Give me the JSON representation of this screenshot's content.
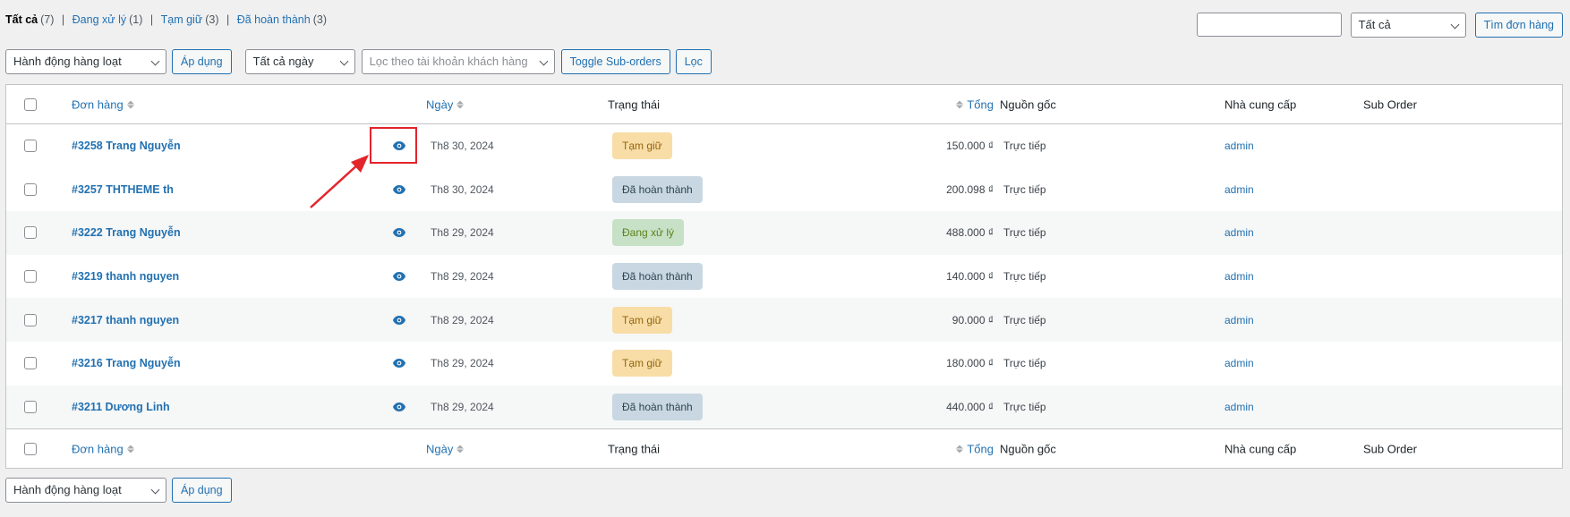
{
  "status_filter": {
    "items": [
      {
        "label": "Tất cả",
        "count": "(7)",
        "current": true
      },
      {
        "label": "Đang xử lý",
        "count": "(1)",
        "current": false
      },
      {
        "label": "Tạm giữ",
        "count": "(3)",
        "current": false
      },
      {
        "label": "Đã hoàn thành",
        "count": "(3)",
        "current": false
      }
    ],
    "separator": "|"
  },
  "search": {
    "input_value": "",
    "filter_select": "Tất cả",
    "button_label": "Tìm đơn hàng"
  },
  "top_nav": {
    "bulk_action": "Hành động hàng loạt",
    "apply_label": "Áp dụng",
    "date_filter": "Tất cả ngày",
    "customer_filter_placeholder": "Lọc theo tài khoản khách hàng",
    "toggle_suborders_label": "Toggle Sub-orders",
    "filter_label": "Lọc"
  },
  "bottom_nav": {
    "bulk_action": "Hành động hàng loạt",
    "apply_label": "Áp dụng"
  },
  "columns": {
    "order": "Đơn hàng",
    "date": "Ngày",
    "status": "Trạng thái",
    "total": "Tổng",
    "origin": "Nguồn gốc",
    "vendor": "Nhà cung cấp",
    "sub_order": "Sub Order"
  },
  "orders": [
    {
      "order": "#3258 Trang Nguyễn",
      "date": "Th8 30, 2024",
      "status": "Tạm giữ",
      "status_type": "on-hold",
      "total": "150.000 ₫",
      "origin": "Trực tiếp",
      "vendor": "admin"
    },
    {
      "order": "#3257 THTHEME th",
      "date": "Th8 30, 2024",
      "status": "Đã hoàn thành",
      "status_type": "completed",
      "total": "200.098 ₫",
      "origin": "Trực tiếp",
      "vendor": "admin"
    },
    {
      "order": "#3222 Trang Nguyễn",
      "date": "Th8 29, 2024",
      "status": "Đang xử lý",
      "status_type": "processing",
      "total": "488.000 ₫",
      "origin": "Trực tiếp",
      "vendor": "admin"
    },
    {
      "order": "#3219 thanh nguyen",
      "date": "Th8 29, 2024",
      "status": "Đã hoàn thành",
      "status_type": "completed",
      "total": "140.000 ₫",
      "origin": "Trực tiếp",
      "vendor": "admin"
    },
    {
      "order": "#3217 thanh nguyen",
      "date": "Th8 29, 2024",
      "status": "Tạm giữ",
      "status_type": "on-hold",
      "total": "90.000 ₫",
      "origin": "Trực tiếp",
      "vendor": "admin"
    },
    {
      "order": "#3216 Trang Nguyễn",
      "date": "Th8 29, 2024",
      "status": "Tạm giữ",
      "status_type": "on-hold",
      "total": "180.000 ₫",
      "origin": "Trực tiếp",
      "vendor": "admin"
    },
    {
      "order": "#3211 Dương Linh",
      "date": "Th8 29, 2024",
      "status": "Đã hoàn thành",
      "status_type": "completed",
      "total": "440.000 ₫",
      "origin": "Trực tiếp",
      "vendor": "admin"
    }
  ],
  "icons": {
    "preview": "eye-icon",
    "sort": "sort-arrows-icon",
    "dropdown": "chevron-down-icon"
  },
  "colors": {
    "link": "#2271b1",
    "on_hold_bg": "#f8dda7",
    "processing_bg": "#c6e1c6",
    "completed_bg": "#c8d7e1",
    "annotation": "#e3242b"
  }
}
